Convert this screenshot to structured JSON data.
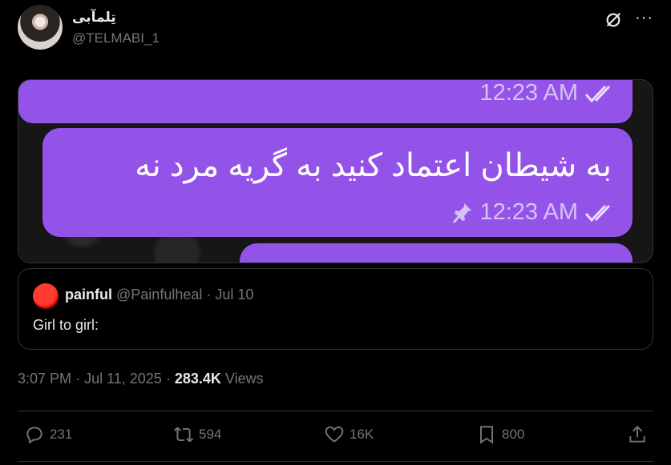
{
  "author": {
    "display_name": "تِلمآبی",
    "handle": "@TELMABI_1"
  },
  "media": {
    "bubbles": [
      {
        "time": "12:23 AM"
      },
      {
        "text": "به شیطان اعتماد کنید به گریه مرد نه",
        "time": "12:23 AM",
        "pinned": true
      }
    ]
  },
  "quote": {
    "name": "painful",
    "handle": "@Painfulheal",
    "date": "Jul 10",
    "text": "Girl to girl:"
  },
  "stats": {
    "time": "3:07 PM",
    "date": "Jul 11, 2025",
    "views_count": "283.4K",
    "views_label": "Views"
  },
  "actions": {
    "replies": "231",
    "reposts": "594",
    "likes": "16K",
    "bookmarks": "800"
  },
  "colors": {
    "bubble": "#9453e8",
    "background": "#000000",
    "muted": "#71767b"
  }
}
